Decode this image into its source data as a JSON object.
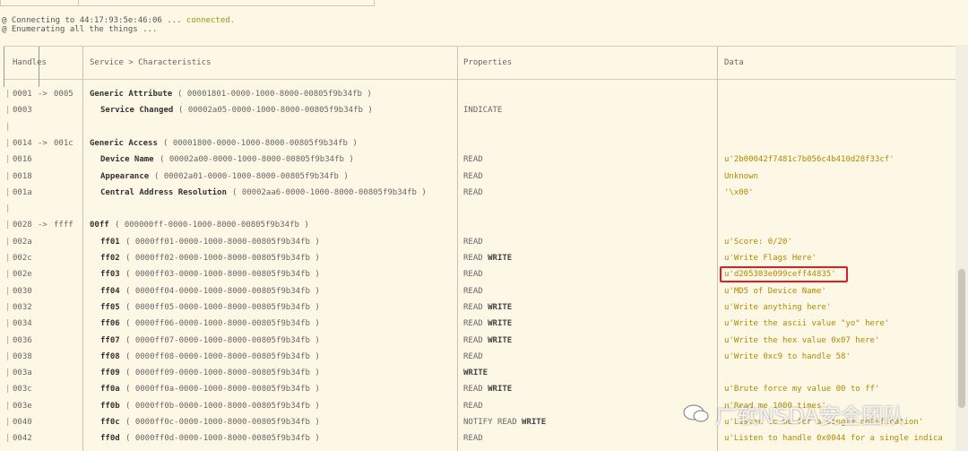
{
  "connect": {
    "line1_pre": "@ Connecting to 44:17:93:5e:46:06 ... ",
    "line1_status": "connected.",
    "line2": "@ Enumerating all the things ..."
  },
  "header": {
    "handles": "Handles",
    "service": "Service > Characteristics",
    "properties": "Properties",
    "data": "Data"
  },
  "rows": [
    {
      "handle": "0001",
      "end": "0005",
      "service": "Generic Attribute",
      "uuid": "( 00001801-0000-1000-8000-00805f9b34fb )",
      "props": "",
      "data": ""
    },
    {
      "handle": "0003",
      "char": "Service Changed",
      "uuid": "( 00002a05-0000-1000-8000-00805f9b34fb )",
      "props": "INDICATE",
      "data": ""
    },
    {
      "blank": true
    },
    {
      "handle": "0014",
      "end": "001c",
      "service": "Generic Access",
      "uuid": "( 00001800-0000-1000-8000-00805f9b34fb )",
      "props": "",
      "data": ""
    },
    {
      "handle": "0016",
      "char": "Device Name",
      "uuid": "( 00002a00-0000-1000-8000-00805f9b34fb )",
      "props": "READ",
      "data": "u'2b00042f7481c7b056c4b410d28f33cf'"
    },
    {
      "handle": "0018",
      "char": "Appearance",
      "uuid": "( 00002a01-0000-1000-8000-00805f9b34fb )",
      "props": "READ",
      "data": "Unknown"
    },
    {
      "handle": "001a",
      "char": "Central Address Resolution",
      "uuid": "( 00002aa6-0000-1000-8000-00805f9b34fb )",
      "props": "READ",
      "data": "'\\x00'"
    },
    {
      "blank": true
    },
    {
      "handle": "0028",
      "end": "ffff",
      "service": "00ff",
      "uuid": "( 000000ff-0000-1000-8000-00805f9b34fb )",
      "props": "",
      "data": ""
    },
    {
      "handle": "002a",
      "char": "ff01",
      "uuid": "( 0000ff01-0000-1000-8000-00805f9b34fb )",
      "props": "READ",
      "data": "u'Score: 0/20'"
    },
    {
      "handle": "002c",
      "char": "ff02",
      "uuid": "( 0000ff02-0000-1000-8000-00805f9b34fb )",
      "props": "READ WRITE",
      "data": "u'Write Flags Here'"
    },
    {
      "handle": "002e",
      "char": "ff03",
      "uuid": "( 0000ff03-0000-1000-8000-00805f9b34fb )",
      "props": "READ",
      "data": "u'd205303e099ceff44835'"
    },
    {
      "handle": "0030",
      "char": "ff04",
      "uuid": "( 0000ff04-0000-1000-8000-00805f9b34fb )",
      "props": "READ",
      "data": "u'MD5 of Device Name'"
    },
    {
      "handle": "0032",
      "char": "ff05",
      "uuid": "( 0000ff05-0000-1000-8000-00805f9b34fb )",
      "props": "READ WRITE",
      "data": "u'Write anything here'"
    },
    {
      "handle": "0034",
      "char": "ff06",
      "uuid": "( 0000ff06-0000-1000-8000-00805f9b34fb )",
      "props": "READ WRITE",
      "data": "u'Write the ascii value \"yo\" here'"
    },
    {
      "handle": "0036",
      "char": "ff07",
      "uuid": "( 0000ff07-0000-1000-8000-00805f9b34fb )",
      "props": "READ WRITE",
      "data": "u'Write the hex value 0x07 here'"
    },
    {
      "handle": "0038",
      "char": "ff08",
      "uuid": "( 0000ff08-0000-1000-8000-00805f9b34fb )",
      "props": "READ",
      "data": "u'Write 0xc9 to handle 58'"
    },
    {
      "handle": "003a",
      "char": "ff09",
      "uuid": "( 0000ff09-0000-1000-8000-00805f9b34fb )",
      "props": "WRITE",
      "data": ""
    },
    {
      "handle": "003c",
      "char": "ff0a",
      "uuid": "( 0000ff0a-0000-1000-8000-00805f9b34fb )",
      "props": "READ WRITE",
      "data": "u'Brute force my value 00 to ff'"
    },
    {
      "handle": "003e",
      "char": "ff0b",
      "uuid": "( 0000ff0b-0000-1000-8000-00805f9b34fb )",
      "props": "READ",
      "data": "u'Read me 1000 times'"
    },
    {
      "handle": "0040",
      "char": "ff0c",
      "uuid": "( 0000ff0c-0000-1000-8000-00805f9b34fb )",
      "props": "NOTIFY READ WRITE",
      "data": "u'Listen to me for a single notification'"
    },
    {
      "handle": "0042",
      "char": "ff0d",
      "uuid": "( 0000ff0d-0000-1000-8000-00805f9b34fb )",
      "props": "READ",
      "data": "u'Listen to handle 0x0044 for a single indica"
    }
  ],
  "watermark": "广软NSDA安全团队",
  "colors": {
    "background": "#fdf7e6",
    "data_text": "#b08a00",
    "connected": "#8a9a1a",
    "highlight": "#e02020"
  }
}
